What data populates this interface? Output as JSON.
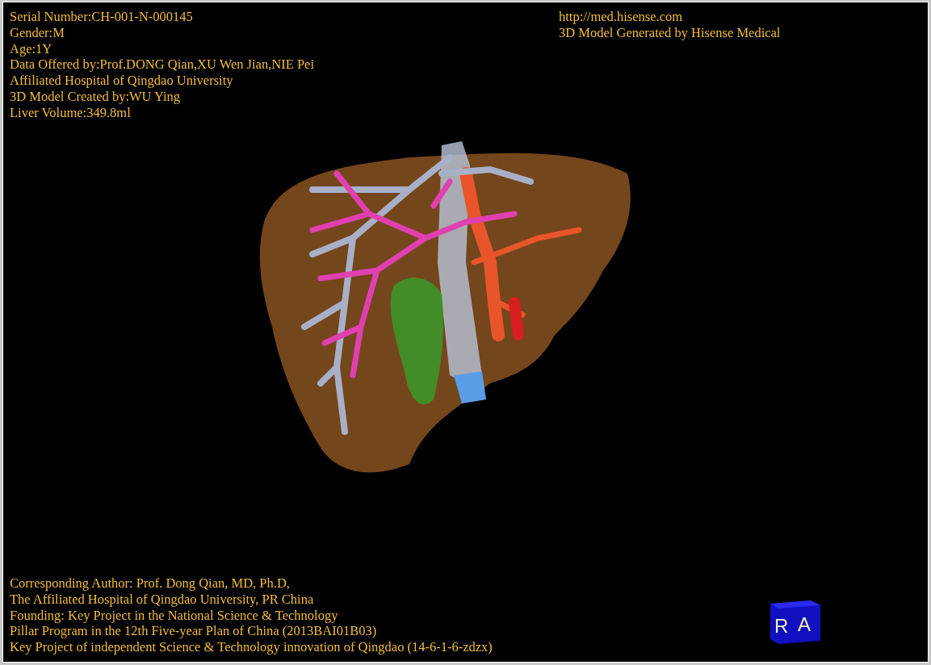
{
  "patient_info": [
    "Serial Number:CH-001-N-000145",
    "Gender:M",
    "Age:1Y",
    "Data Offered by:Prof.DONG Qian,XU Wen Jian,NIE Pei",
    "Affiliated Hospital of Qingdao University",
    "3D Model Created by:WU Ying",
    "Liver Volume:349.8ml"
  ],
  "generator_info": [
    "http://med.hisense.com",
    "3D Model Generated by Hisense Medical"
  ],
  "credits": [
    "Corresponding Author: Prof. Dong Qian, MD, Ph.D,",
    "The Affiliated Hospital of Qingdao University, PR China",
    "Founding: Key Project in the National Science & Technology",
    "Pillar Program in the 12th Five-year Plan of China (2013BAI01B03)",
    "Key Project of independent Science & Technology innovation of Qingdao (14-6-1-6-zdzx)"
  ],
  "orientation_cube": {
    "faces": [
      "R",
      "A"
    ]
  }
}
